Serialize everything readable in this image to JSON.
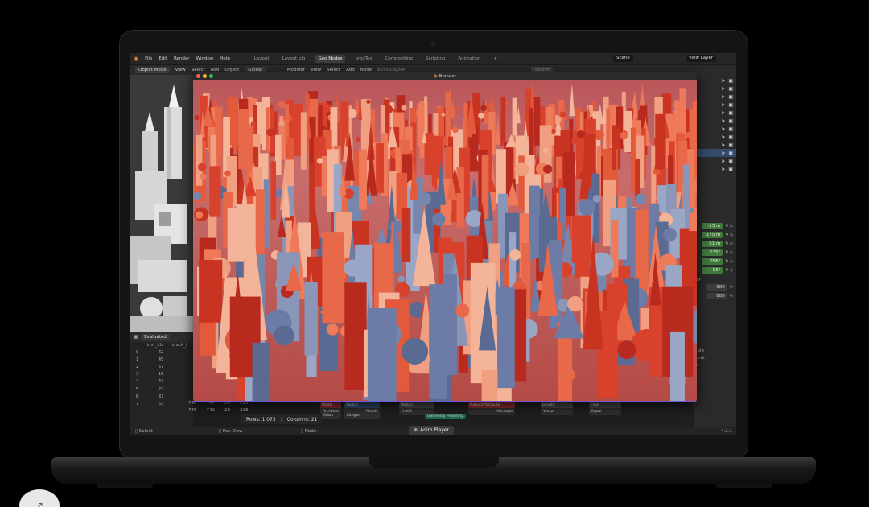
{
  "topbar": {
    "menus": [
      "File",
      "Edit",
      "Render",
      "Window",
      "Help"
    ],
    "workspaces": [
      {
        "label": "Layout",
        "active": false
      },
      {
        "label": "Layout.blg",
        "active": false
      },
      {
        "label": "Geo Nodes",
        "active": true
      },
      {
        "label": "procTex",
        "active": false
      },
      {
        "label": "Compositing",
        "active": false
      },
      {
        "label": "Scripting",
        "active": false
      },
      {
        "label": "Animation",
        "active": false
      }
    ],
    "add_tab": "+",
    "scene": "Scene",
    "view_layer": "View Layer"
  },
  "toolbar": {
    "mode": "Object Mode",
    "items": [
      "View",
      "Select",
      "Add",
      "Object"
    ],
    "transform": "Global",
    "modifier": "Modifier",
    "node_items": [
      "View",
      "Select",
      "Add",
      "Node"
    ],
    "build_layout": "Build Layout",
    "search_placeholder": "Search"
  },
  "render_window": {
    "title": "Blender"
  },
  "spreadsheet": {
    "mode": "Evaluated",
    "columns": [
      "",
      "inst_idx",
      "stack_l"
    ],
    "rows": [
      [
        "0",
        "42"
      ],
      [
        "1",
        "45"
      ],
      [
        "2",
        "57"
      ],
      [
        "3",
        "16"
      ],
      [
        "4",
        "47"
      ],
      [
        "5",
        "22"
      ],
      [
        "6",
        "37"
      ],
      [
        "7",
        "53"
      ]
    ],
    "extra_rows": [
      [
        "740",
        "747",
        "20",
        "223"
      ],
      [
        "745",
        "742",
        "20",
        "228"
      ]
    ],
    "rows_label": "Rows: 1,073",
    "columns_label": "Columns: 21"
  },
  "outliner": {
    "selected_index": 9
  },
  "properties": {
    "green_values": [
      "-13 m",
      "175 m",
      "51 m",
      "135°",
      "056°",
      "93°"
    ],
    "gray_values": [
      "000",
      "000"
    ],
    "labels": [
      "er",
      "ible",
      "orts",
      "s"
    ],
    "custom_properties": "Custom Properties"
  },
  "nodes": [
    {
      "title": "Mode",
      "color": "#8a2b2b",
      "rows": [
        "Attribute",
        "Exists"
      ]
    },
    {
      "title": "Switch",
      "color": "#2b4a6a",
      "rows": [
        "Result",
        "Integer"
      ]
    },
    {
      "title": "Option",
      "color": "#444444",
      "rows": [
        "0.000"
      ]
    },
    {
      "title": "Geometry Proximity",
      "color": "#1f6a4a",
      "rows": []
    },
    {
      "title": "Named Attribute",
      "color": "#8a2b2b",
      "rows": [
        "Attribute"
      ]
    },
    {
      "title": "Length",
      "color": "#444444",
      "rows": [
        "Vector"
      ]
    },
    {
      "title": "Float",
      "color": "#444444",
      "rows": [
        "Equal"
      ]
    }
  ],
  "statusbar": {
    "select": "Select",
    "pan": "Pan View",
    "node": "Node",
    "anim_player": "Anim Player",
    "version": "4.2.1"
  },
  "colors": {
    "accent": "#e9902b",
    "selection": "#334b6d",
    "prop_green": "#3f7a3b",
    "render_bottom": "#6a5bd6"
  }
}
